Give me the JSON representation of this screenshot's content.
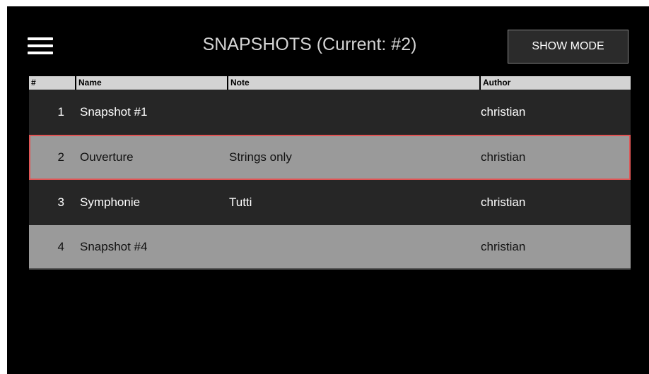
{
  "header": {
    "title": "SNAPSHOTS (Current: #2)",
    "show_mode_label": "SHOW MODE"
  },
  "table": {
    "columns": [
      "#",
      "Name",
      "Note",
      "Author"
    ],
    "rows": [
      {
        "num": "1",
        "name": "Snapshot #1",
        "note": "",
        "author": "christian"
      },
      {
        "num": "2",
        "name": "Ouverture",
        "note": "Strings only",
        "author": "christian"
      },
      {
        "num": "3",
        "name": "Symphonie",
        "note": "Tutti",
        "author": "christian"
      },
      {
        "num": "4",
        "name": "Snapshot #4",
        "note": "",
        "author": "christian"
      }
    ]
  },
  "colors": {
    "background": "#000000",
    "header_cell": "#d3d3d3",
    "row_dark": "#262626",
    "row_light": "#9a9a9a",
    "current_highlight": "#e05555"
  },
  "icons": {
    "menu": "hamburger-menu-icon"
  }
}
